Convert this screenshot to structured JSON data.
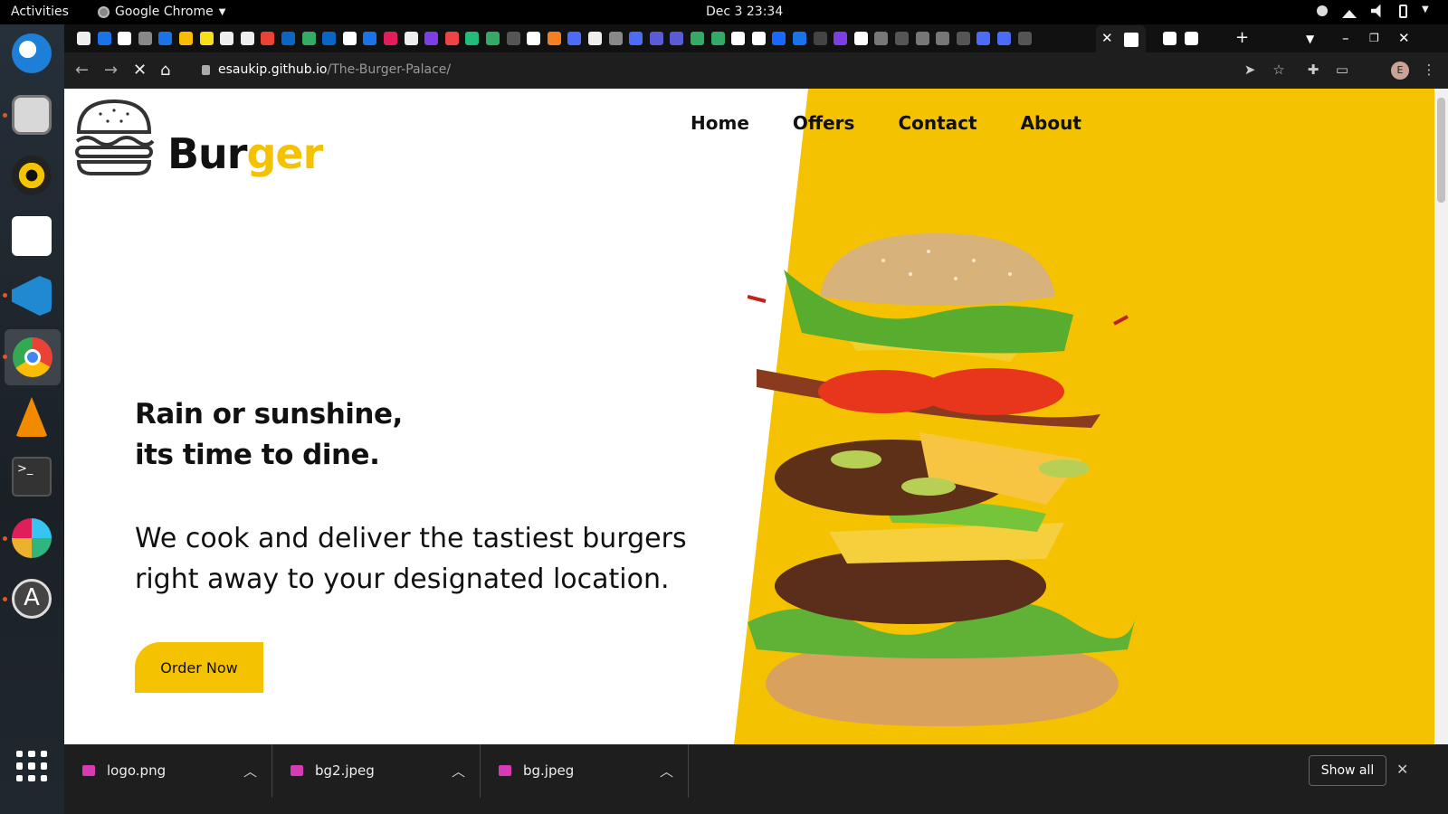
{
  "system_bar": {
    "activities": "Activities",
    "app_name": "Google Chrome",
    "clock": "Dec 3  23:34"
  },
  "browser": {
    "url_host": "esaukip.github.io",
    "url_path": "/The-Burger-Palace/",
    "profile_initial": "E"
  },
  "site": {
    "brand_part1": "Bur",
    "brand_part2": "ger",
    "nav": [
      "Home",
      "Offers",
      "Contact",
      "About"
    ],
    "headline_line1": "Rain or sunshine,",
    "headline_line2": "its time to dine.",
    "tagline": "We cook and deliver the tastiest burgers right away to your designated location.",
    "cta": "Order Now",
    "colors": {
      "accent": "#f4c200",
      "text": "#111111",
      "background": "#ffffff"
    }
  },
  "downloads": {
    "items": [
      "logo.png",
      "bg2.jpeg",
      "bg.jpeg"
    ],
    "show_all": "Show all"
  }
}
